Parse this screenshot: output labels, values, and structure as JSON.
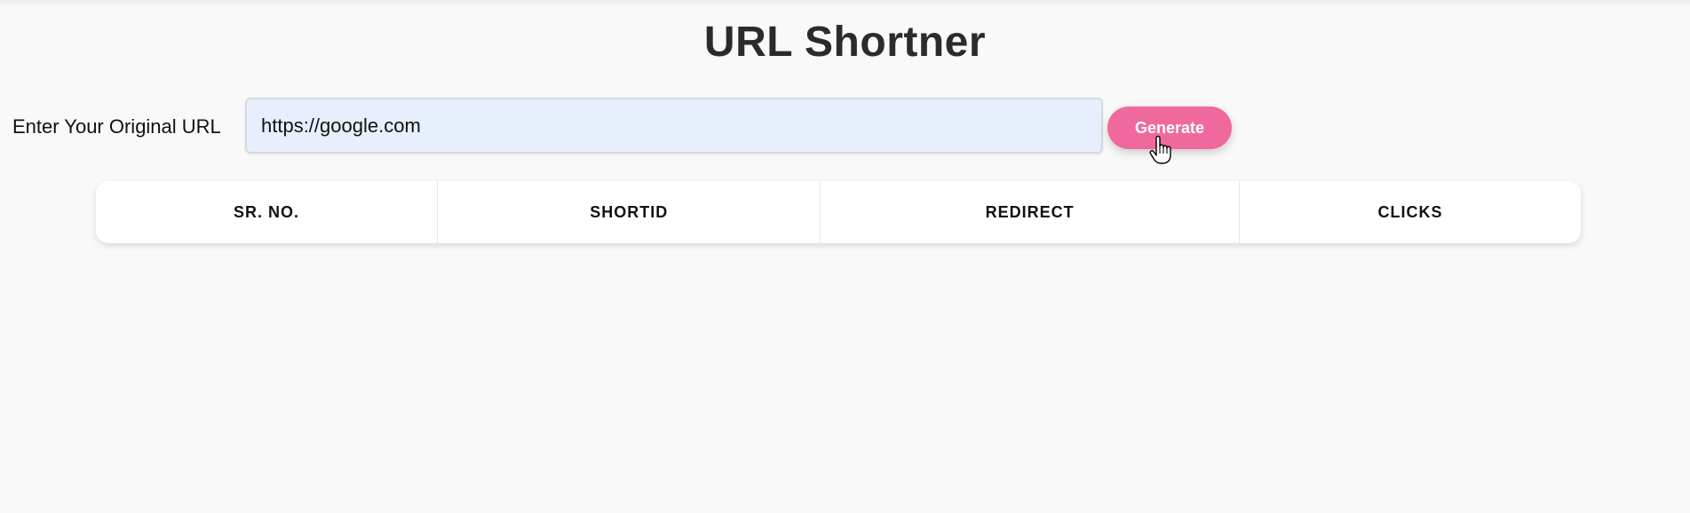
{
  "page": {
    "title": "URL Shortner"
  },
  "form": {
    "label": "Enter Your Original URL",
    "url_value": "https://google.com",
    "generate_label": "Generate"
  },
  "table": {
    "headers": [
      "SR. NO.",
      "SHORTID",
      "REDIRECT",
      "CLICKS"
    ],
    "rows": []
  },
  "colors": {
    "background": "#f9f9f9",
    "button": "#f0699c",
    "input_background": "#e8effc"
  },
  "icons": {
    "cursor": "hand-pointer-cursor-icon"
  }
}
